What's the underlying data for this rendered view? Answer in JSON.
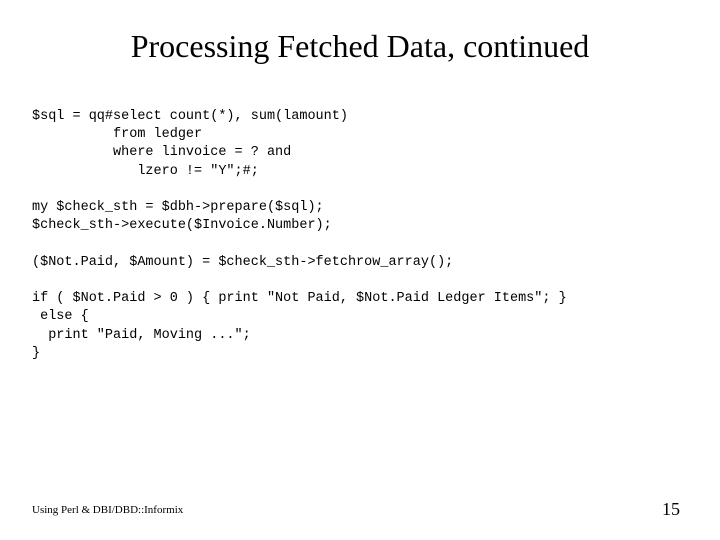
{
  "title": "Processing Fetched Data, continued",
  "code": "$sql = qq#select count(*), sum(lamount)\n          from ledger\n          where linvoice = ? and\n             lzero != \"Y\";#;\n\nmy $check_sth = $dbh->prepare($sql);\n$check_sth->execute($Invoice.Number);\n\n($Not.Paid, $Amount) = $check_sth->fetchrow_array();\n\nif ( $Not.Paid > 0 ) { print \"Not Paid, $Not.Paid Ledger Items\"; }\n else {\n  print \"Paid, Moving ...\";\n}",
  "footer": "Using Perl & DBI/DBD::Informix",
  "page_number": "15"
}
